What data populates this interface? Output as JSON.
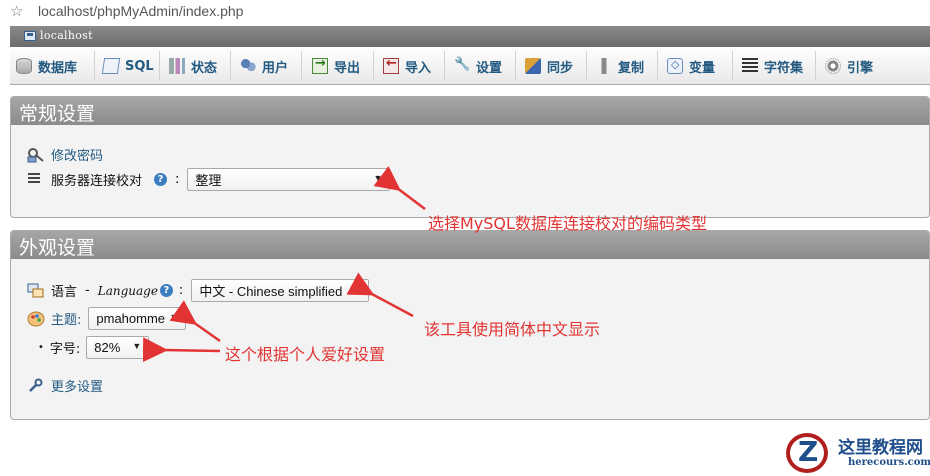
{
  "browser": {
    "url": "localhost/phpMyAdmin/index.php"
  },
  "server_bar": {
    "label": "localhost"
  },
  "tabs": [
    {
      "label": "数据库",
      "icon": "database-icon"
    },
    {
      "label": "SQL",
      "icon": "sql-icon"
    },
    {
      "label": "状态",
      "icon": "status-icon"
    },
    {
      "label": "用户",
      "icon": "users-icon"
    },
    {
      "label": "导出",
      "icon": "export-icon"
    },
    {
      "label": "导入",
      "icon": "import-icon"
    },
    {
      "label": "设置",
      "icon": "wrench-icon"
    },
    {
      "label": "同步",
      "icon": "sync-icon"
    },
    {
      "label": "复制",
      "icon": "replication-icon"
    },
    {
      "label": "变量",
      "icon": "variables-icon"
    },
    {
      "label": "字符集",
      "icon": "charset-icon"
    },
    {
      "label": "引擎",
      "icon": "engine-icon"
    }
  ],
  "general_settings": {
    "title": "常规设置",
    "change_password": "修改密码",
    "collation_label": "服务器连接校对",
    "collation_help": "?",
    "collation_colon": ":",
    "collation_value": "整理"
  },
  "appearance_settings": {
    "title": "外观设置",
    "language_label": "语言",
    "language_dash": "-",
    "language_en": "Language",
    "language_value": "中文 - Chinese simplified",
    "theme_label": "主题:",
    "theme_value": "pmahomme",
    "fontsize_bullet": "•",
    "fontsize_label": "字号:",
    "fontsize_value": "82%",
    "more_settings": "更多设置"
  },
  "annotations": {
    "collation_note": "选择MySQL数据库连接校对的编码类型",
    "language_note": "该工具使用简体中文显示",
    "preference_note": "这个根据个人爱好设置"
  },
  "watermark": {
    "title": "这里教程网",
    "subtitle": "herecours.com"
  },
  "colors": {
    "link": "#235a81",
    "annotation": "#e23434",
    "panel_header": "#9a9a9a"
  }
}
